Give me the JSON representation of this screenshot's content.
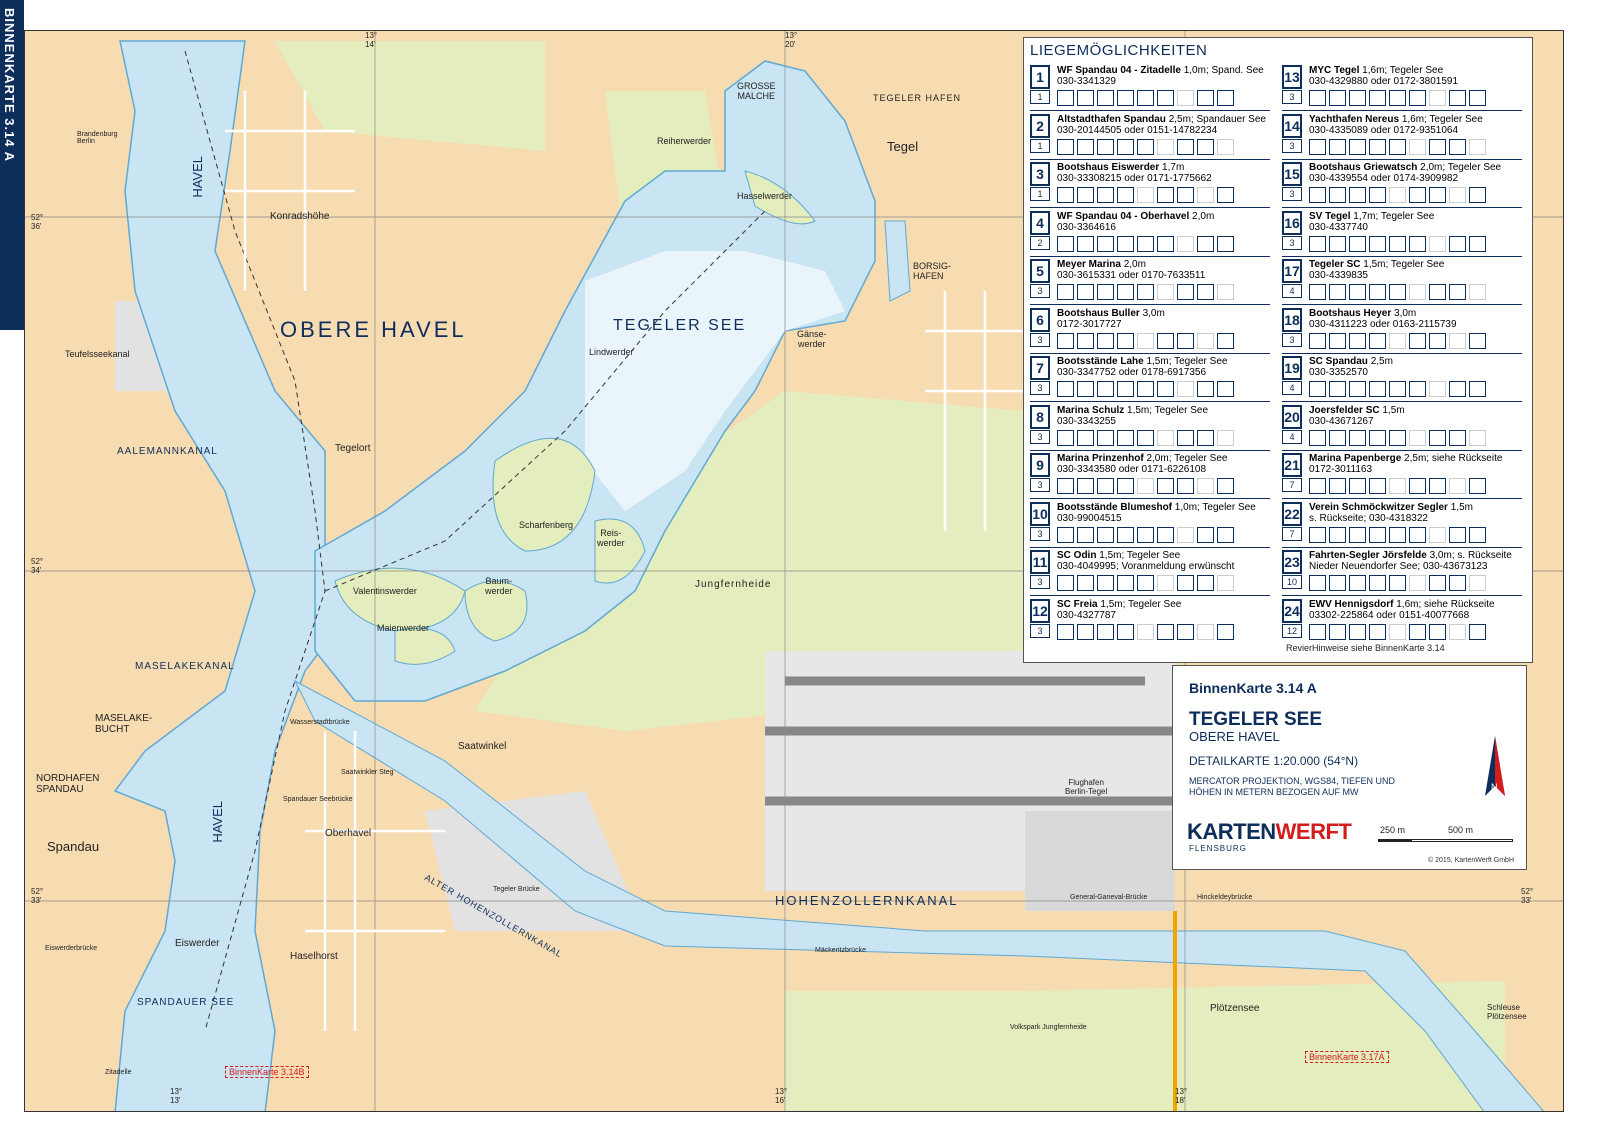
{
  "sidebar_title": "BINNENKARTE 3.14 A",
  "map_labels": {
    "obere_havel": "OBERE HAVEL",
    "tegeler_see": "TEGELER SEE",
    "havel_top": "HAVEL",
    "havel_bottom": "HAVEL",
    "hohenzollernkanal": "HOHENZOLLERNKANAL",
    "alter_hohenzollernkanal": "ALTER HOHENZOLLERNKANAL",
    "aalemannkanal": "AALEMANNKANAL",
    "maselakekanal": "MASELAKEKANAL",
    "teufelsseekanal": "Teufelsseekanal",
    "spandauer_see": "SPANDAUER SEE",
    "spandau": "Spandau",
    "tegel": "Tegel",
    "tegeler_hafen": "TEGELER HAFEN",
    "borsighafen": "BORSIG-\nHAFEN",
    "grosse_malche": "GROSSE\nMALCHE",
    "jungfernheide": "Jungfernheide",
    "konradshohe": "Konradshöhe",
    "tegelort": "Tegelort",
    "oberhavel": "Oberhavel",
    "saatwinkel": "Saatwinkel",
    "haselhorst": "Haselhorst",
    "plotzensee": "Plötzensee",
    "flughafen": "Flughafen\nBerlin-Tegel",
    "volkspark": "Volkspark Jungfernheide",
    "scharfenberg": "Scharfenberg",
    "valentinswerder": "Valentinswerder",
    "maienwerder": "Maienwerder",
    "baumwerder": "Baum-\nwerder",
    "reiswerder": "Reis-\nwerder",
    "lindwerder": "Lindwerder",
    "hasselwerder": "Hasselwerder",
    "reiherwerder": "Reiherwerder",
    "gansewerder": "Gänse-\nwerder",
    "eiswerder": "Eiswerder",
    "maselake_bucht": "MASELAKE-\nBUCHT",
    "nordhafen": "NORDHAFEN\nSPANDAU",
    "binnenkarte_314b": "BinnenKarte 3.14B",
    "binnenkarte_317a": "BinnenKarte 3.17A",
    "schleuse": "Schleuse\nPlötzensee",
    "brandenburg_berlin": "Brandenburg\nBerlin",
    "tegeler_brucke": "Tegeler Brücke",
    "mackeritzbrucke": "Mäckeritzbrücke",
    "saatwinkler_steg": "Saatwinkler Steg",
    "wasserstadtbrucke": "Wasserstadtbrücke",
    "spandauer_seebrucke": "Spandauer Seebrücke",
    "eiswerderbrucke": "Eiswerderbrücke",
    "zitadelle": "Zitadelle",
    "hinckeldeybrucke": "Hinckeldeybrücke",
    "general_ganeval_brucke": "General-Ganeval-Brücke",
    "lat_top": "52°\n36'",
    "lat_mid": "52°\n34'",
    "lat_bottom": "52°\n33'",
    "lat_right": "52°\n33'",
    "lon_13_14": "13°\n14'",
    "lon_13_16": "13°\n16'",
    "lon_13_18": "13°\n18'",
    "lon_13_20": "13°\n20'",
    "lon_13_13": "13°\n13'"
  },
  "moorings_title": "LIEGEMÖGLICHKEITEN",
  "moorings": [
    {
      "n": "1",
      "sub": "1",
      "name": "WF Spandau 04 - Zitadelle",
      "detail": "1,0m; Spand. See",
      "phone": "030-3341329"
    },
    {
      "n": "2",
      "sub": "1",
      "name": "Altstadthafen Spandau",
      "detail": "2,5m; Spandauer See",
      "phone": "030-20144505 oder 0151-14782234"
    },
    {
      "n": "3",
      "sub": "1",
      "name": "Bootshaus Eiswerder",
      "detail": "1,7m",
      "phone": "030-33308215 oder 0171-1775662"
    },
    {
      "n": "4",
      "sub": "2",
      "name": "WF Spandau 04 - Oberhavel",
      "detail": "2,0m",
      "phone": "030-3364616"
    },
    {
      "n": "5",
      "sub": "3",
      "name": "Meyer Marina",
      "detail": "2,0m",
      "phone": "030-3615331 oder 0170-7633511"
    },
    {
      "n": "6",
      "sub": "3",
      "name": "Bootshaus Buller",
      "detail": "3,0m",
      "phone": "0172-3017727"
    },
    {
      "n": "7",
      "sub": "3",
      "name": "Bootsstände Lahe",
      "detail": "1,5m; Tegeler See",
      "phone": "030-3347752 oder 0178-6917356"
    },
    {
      "n": "8",
      "sub": "3",
      "name": "Marina Schulz",
      "detail": "1,5m; Tegeler See",
      "phone": "030-3343255"
    },
    {
      "n": "9",
      "sub": "3",
      "name": "Marina Prinzenhof",
      "detail": "2,0m; Tegeler See",
      "phone": "030-3343580 oder 0171-6226108"
    },
    {
      "n": "10",
      "sub": "3",
      "name": "Bootsstände Blumeshof",
      "detail": "1,0m; Tegeler See",
      "phone": "030-99004515"
    },
    {
      "n": "11",
      "sub": "3",
      "name": "SC Odin",
      "detail": "1,5m; Tegeler See",
      "phone": "030-4049995; Voranmeldung erwünscht"
    },
    {
      "n": "12",
      "sub": "3",
      "name": "SC Freia",
      "detail": "1,5m; Tegeler See",
      "phone": "030-4327787"
    },
    {
      "n": "13",
      "sub": "3",
      "name": "MYC Tegel",
      "detail": "1,6m; Tegeler See",
      "phone": "030-4329880 oder 0172-3801591"
    },
    {
      "n": "14",
      "sub": "3",
      "name": "Yachthafen Nereus",
      "detail": "1,6m; Tegeler See",
      "phone": "030-4335089 oder 0172-9351064"
    },
    {
      "n": "15",
      "sub": "3",
      "name": "Bootshaus Griewatsch",
      "detail": "2,0m; Tegeler See",
      "phone": "030-4339554 oder 0174-3909982"
    },
    {
      "n": "16",
      "sub": "3",
      "name": "SV Tegel",
      "detail": "1,7m; Tegeler See",
      "phone": "030-4337740"
    },
    {
      "n": "17",
      "sub": "4",
      "name": "Tegeler SC",
      "detail": "1,5m; Tegeler See",
      "phone": "030-4339835"
    },
    {
      "n": "18",
      "sub": "3",
      "name": "Bootshaus Heyer",
      "detail": "3,0m",
      "phone": "030-4311223 oder 0163-2115739"
    },
    {
      "n": "19",
      "sub": "4",
      "name": "SC Spandau",
      "detail": "2,5m",
      "phone": "030-3352570"
    },
    {
      "n": "20",
      "sub": "4",
      "name": "Joersfelder SC",
      "detail": "1,5m",
      "phone": "030-43671267"
    },
    {
      "n": "21",
      "sub": "7",
      "name": "Marina Papenberge",
      "detail": "2,5m; siehe Rückseite",
      "phone": "0172-3011163"
    },
    {
      "n": "22",
      "sub": "7",
      "name": "Verein Schmöckwitzer Segler",
      "detail": "1,5m",
      "phone": "s. Rückseite; 030-4318322"
    },
    {
      "n": "23",
      "sub": "10",
      "name": "Fahrten-Segler Jörsfelde",
      "detail": "3,0m; s. Rückseite",
      "phone": "Nieder Neuendorfer See; 030-43673123"
    },
    {
      "n": "24",
      "sub": "12",
      "name": "EWV Hennigsdorf",
      "detail": "1,6m; siehe Rückseite",
      "phone": "03302-225864 oder 0151-40077668"
    }
  ],
  "panel_note": "RevierHinweise siehe BinnenKarte 3.14",
  "title_box": {
    "chart_no": "BinnenKarte 3.14 A",
    "name": "TEGELER SEE",
    "subname": "OBERE HAVEL",
    "scale": "DETAILKARTE 1:20.000 (54°N)",
    "projection": "MERCATOR PROJEKTION, WGS84, TIEFEN UND HÖHEN IN METERN BEZOGEN AUF MW",
    "brand_a": "KARTEN",
    "brand_b": "WERFT",
    "brand_city": "FLENSBURG",
    "copyright": "© 2015, KartenWerft GmbH",
    "scale_250": "250 m",
    "scale_500": "500 m",
    "north": "N"
  },
  "colors": {
    "water": "#c9e4f3",
    "land": "#f7dcb2",
    "green": "#e3edbd",
    "navy": "#0d2d5a",
    "red": "#d41c1c"
  }
}
